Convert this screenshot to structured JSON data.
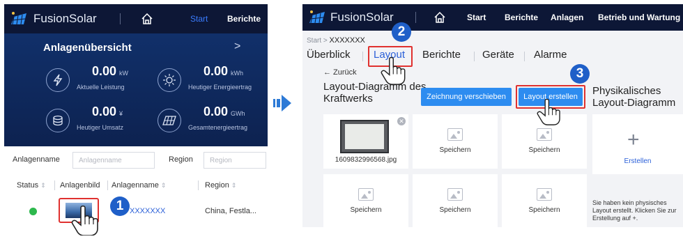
{
  "left_screen": {
    "brand": "FusionSolar",
    "nav": {
      "start": "Start",
      "berichte": "Berichte"
    },
    "overview": {
      "title": "Anlagenübersicht",
      "more": ">",
      "metrics": [
        {
          "value": "0.00",
          "unit": "kW",
          "label": "Aktuelle Leistung",
          "icon": "lightning-icon"
        },
        {
          "value": "0.00",
          "unit": "kWh",
          "label": "Heutiger Energieertrag",
          "icon": "solar-icon"
        },
        {
          "value": "0.00",
          "unit": "¥",
          "label": "Heutiger Umsatz",
          "icon": "coins-icon"
        },
        {
          "value": "0.00",
          "unit": "GWh",
          "label": "Gesamtenergieertrag",
          "icon": "panel-icon"
        }
      ]
    },
    "filter": {
      "name_label": "Anlagenname",
      "name_placeholder": "Anlagenname",
      "region_label": "Region",
      "region_placeholder": "Region"
    },
    "table": {
      "columns": [
        "Status",
        "Anlagenbild",
        "Anlagenname",
        "Region"
      ],
      "rows": [
        {
          "status": "online",
          "name": "XXXXXXX",
          "region": "China, Festla..."
        }
      ]
    },
    "step_badge": "1"
  },
  "right_screen": {
    "brand": "FusionSolar",
    "nav": [
      "Start",
      "Berichte",
      "Anlagen",
      "Betrieb und Wartung"
    ],
    "breadcrumb": {
      "root": "Start",
      "separator": ">",
      "current": "XXXXXXX"
    },
    "tabs": [
      "Überblick",
      "Layout",
      "Berichte",
      "Geräte",
      "Alarme"
    ],
    "back_label": "← Zurück",
    "layout_title": "Layout-Diagramm des Kraftwerks",
    "move_button": "Zeichnung verschieben",
    "create_layout_button": "Layout erstellen",
    "physical_title": "Physikalisches Layout-Diagramm",
    "photo_name": "1609832996568.jpg",
    "slot_label": "Speichern",
    "create_label": "Erstellen",
    "hint_text": "Sie haben kein physisches Layout erstellt. Klicken Sie zur Erstellung auf +.",
    "step_badges": [
      "2",
      "3"
    ]
  },
  "colors": {
    "topbar": "#0d1736",
    "overview_bg": "#0f2555",
    "accent_blue": "#2d8cf0",
    "highlight_red": "#e0312f",
    "status_green": "#2db84d",
    "badge_blue": "#1f5fc8"
  }
}
